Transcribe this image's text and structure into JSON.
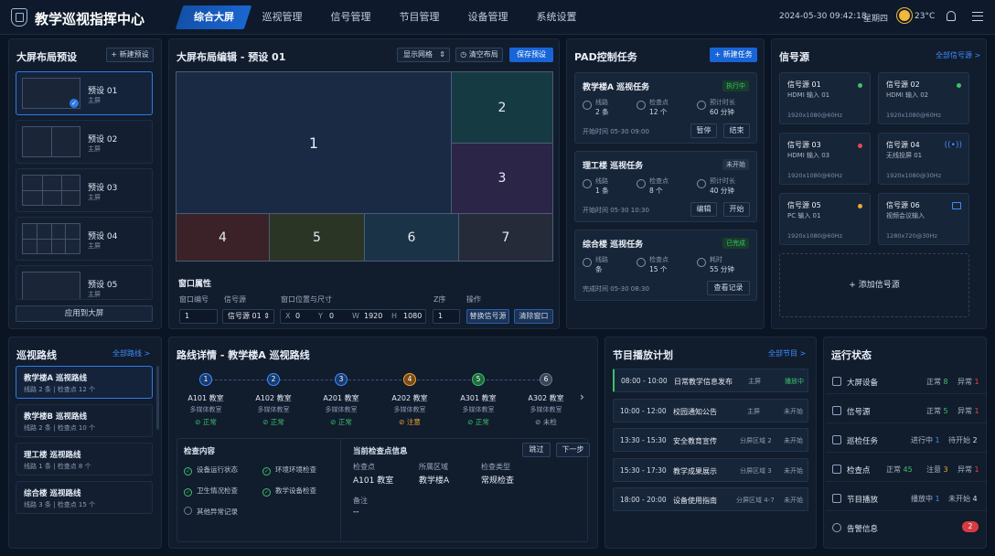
{
  "header": {
    "title": "教学巡视指挥中心",
    "nav": [
      "综合大屏",
      "巡视管理",
      "信号管理",
      "节目管理",
      "设备管理",
      "系统设置"
    ],
    "datetime": "2024-05-30 09:42:18",
    "weekday": "星期四",
    "temperature": "23°C"
  },
  "layout_presets": {
    "title": "大屏布局预设",
    "new_label": "+ 新建预设",
    "apply_label": "应用到大屏",
    "items": [
      {
        "name": "预设 01",
        "sub": "主屏"
      },
      {
        "name": "预设 02",
        "sub": "主屏"
      },
      {
        "name": "预设 03",
        "sub": "主屏"
      },
      {
        "name": "预设 04",
        "sub": "主屏"
      },
      {
        "name": "预设 05",
        "sub": "主屏"
      }
    ]
  },
  "editor": {
    "title": "大屏布局编辑 - 预设 01",
    "grid_select": "显示网格",
    "clear_label": "清空布局",
    "save_label": "保存预设",
    "cells": [
      "1",
      "2",
      "3",
      "4",
      "5",
      "6",
      "7"
    ],
    "props_title": "窗口属性",
    "col_id": "窗口编号",
    "col_signal": "信号源",
    "col_pos": "窗口位置与尺寸",
    "col_z": "Z序",
    "col_ops": "操作",
    "id_value": "1",
    "signal_value": "信号源 01",
    "x_label": "X",
    "x_value": "0",
    "y_label": "Y",
    "y_value": "0",
    "w_label": "W",
    "w_value": "1920",
    "h_label": "H",
    "h_value": "1080",
    "z_value": "1",
    "replace_label": "替换信号源",
    "clear_win_label": "清除窗口"
  },
  "pad": {
    "title": "PAD控制任务",
    "new_label": "+ 新建任务",
    "tasks": [
      {
        "name": "教学楼A 巡视任务",
        "status": "执行中",
        "l1": "线路",
        "v1": "2 条",
        "l2": "检查点",
        "v2": "12 个",
        "l3": "预计时长",
        "v3": "60 分钟",
        "time": "开始时间 05-30 09:00",
        "b1": "暂停",
        "b2": "结束"
      },
      {
        "name": "理工楼 巡视任务",
        "status": "未开始",
        "l1": "线路",
        "v1": "1 条",
        "l2": "检查点",
        "v2": "8 个",
        "l3": "预计时长",
        "v3": "40 分钟",
        "time": "开始时间 05-30 10:30",
        "b1": "编辑",
        "b2": "开始"
      },
      {
        "name": "综合楼 巡视任务",
        "status": "已完成",
        "l1": "线路",
        "v1": "条",
        "l2": "检查点",
        "v2": "15 个",
        "l3": "耗时",
        "v3": "55 分钟",
        "time": "完成时间 05-30 08:30",
        "b1": "查看记录"
      }
    ]
  },
  "signals": {
    "title": "信号源",
    "all_label": "全部信号源 >",
    "add_label": "+ 添加信号源",
    "items": [
      {
        "name": "信号源 01",
        "type": "HDMI 输入 01",
        "res": "1920x1080@60Hz",
        "icon": "status-dot-green"
      },
      {
        "name": "信号源 02",
        "type": "HDMI 输入 02",
        "res": "1920x1080@60Hz",
        "icon": "status-dot-green"
      },
      {
        "name": "信号源 03",
        "type": "HDMI 输入 03",
        "res": "1920x1080@60Hz",
        "icon": "status-dot-red"
      },
      {
        "name": "信号源 04",
        "type": "无线投屏 01",
        "res": "1920x1080@30Hz",
        "icon": "wireless-icon"
      },
      {
        "name": "信号源 05",
        "type": "PC 输入 01",
        "res": "1920x1080@60Hz",
        "icon": "status-dot-yellow"
      },
      {
        "name": "信号源 06",
        "type": "视频会议输入",
        "res": "1280x720@30Hz",
        "icon": "monitor-icon"
      }
    ]
  },
  "routes": {
    "title": "巡视路线",
    "all_label": "全部路线 >",
    "items": [
      {
        "name": "教学楼A 巡视路线",
        "sub": "线路 2 条 | 检查点 12 个"
      },
      {
        "name": "教学楼B 巡视路线",
        "sub": "线路 2 条 | 检查点 10 个"
      },
      {
        "name": "理工楼 巡视路线",
        "sub": "线路 1 条 | 检查点 8 个"
      },
      {
        "name": "综合楼 巡视路线",
        "sub": "线路 3 条 | 检查点 15 个"
      }
    ]
  },
  "route_detail": {
    "title": "路线详情 - 教学楼A 巡视路线",
    "nodes": [
      {
        "num": "1",
        "room": "A101 教室",
        "type": "多媒体教室",
        "status": "正常"
      },
      {
        "num": "2",
        "room": "A102 教室",
        "type": "多媒体教室",
        "status": "正常"
      },
      {
        "num": "3",
        "room": "A201 教室",
        "type": "多媒体教室",
        "status": "正常"
      },
      {
        "num": "4",
        "room": "A202 教室",
        "type": "多媒体教室",
        "status": "注意"
      },
      {
        "num": "5",
        "room": "A301 教室",
        "type": "多媒体教室",
        "status": "正常"
      },
      {
        "num": "6",
        "room": "A302 教室",
        "type": "多媒体教室",
        "status": "未检"
      }
    ],
    "check_title": "检查内容",
    "checks": [
      "设备运行状态",
      "环境环境检查",
      "卫生情况检查",
      "教学设备检查",
      "其他异常记录"
    ],
    "current_title": "当前检查点信息",
    "skip_label": "跳过",
    "next_label": "下一步",
    "f1_label": "检查点",
    "f1_value": "A101 教室",
    "f2_label": "所属区域",
    "f2_value": "教学楼A",
    "f3_label": "检查类型",
    "f3_value": "常规检查",
    "f4_label": "备注",
    "f4_value": "--"
  },
  "programs": {
    "title": "节目播放计划",
    "all_label": "全部节目 >",
    "items": [
      {
        "time": "08:00 - 10:00",
        "name": "日常教学信息发布",
        "area": "主屏",
        "status": "播放中"
      },
      {
        "time": "10:00 - 12:00",
        "name": "校园通知公告",
        "area": "主屏",
        "status": "未开始"
      },
      {
        "time": "13:30 - 15:30",
        "name": "安全教育宣传",
        "area": "分屏区域 2",
        "status": "未开始"
      },
      {
        "time": "15:30 - 17:30",
        "name": "教学成果展示",
        "area": "分屏区域 3",
        "status": "未开始"
      },
      {
        "time": "18:00 - 20:00",
        "name": "设备使用指南",
        "area": "分屏区域 4-7",
        "status": "未开始"
      }
    ]
  },
  "run_status": {
    "title": "运行状态",
    "items": [
      {
        "name": "大屏设备",
        "a": "正常",
        "av": "8",
        "b": "异常",
        "bv": "1"
      },
      {
        "name": "信号源",
        "a": "正常",
        "av": "5",
        "b": "异常",
        "bv": "1"
      },
      {
        "name": "巡检任务",
        "a": "进行中",
        "av": "1",
        "b": "待开始",
        "bv": "2"
      },
      {
        "name": "检查点",
        "a": "正常",
        "av": "45",
        "b": "注意",
        "bv": "3",
        "c": "异常",
        "cv": "1"
      },
      {
        "name": "节目播放",
        "a": "播放中",
        "av": "1",
        "b": "未开始",
        "bv": "4"
      },
      {
        "name": "告警信息",
        "count": "2"
      }
    ]
  },
  "colors": {
    "accent": "#1765d8",
    "ok": "#3cc26b",
    "warn": "#f0a534",
    "err": "#e5484d"
  }
}
